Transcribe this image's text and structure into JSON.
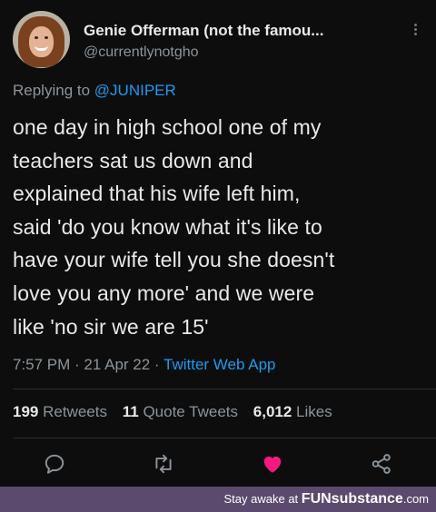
{
  "author": {
    "name": "Genie Offerman (not the famou...",
    "handle": "@currentlynotgho"
  },
  "reply": {
    "prefix": "Replying to ",
    "to": "@JUNIPER"
  },
  "tweet": {
    "lines": [
      "one day in high school one of my",
      "teachers sat us down and",
      "explained that his wife left him,",
      "said 'do you know what it's like to",
      "have your wife tell you she doesn't",
      "love you any more' and we were",
      "like 'no sir we are 15'"
    ],
    "time": "7:57 PM",
    "sep1": " · ",
    "date": "21 Apr 22",
    "sep2": " · ",
    "app": "Twitter Web App"
  },
  "stats": {
    "retweets_count": "199",
    "retweets_label": "Retweets",
    "quotes_count": "11",
    "quotes_label": "Quote Tweets",
    "likes_count": "6,012",
    "likes_label": "Likes"
  },
  "actions": [
    "reply-icon",
    "retweet-icon",
    "like-icon",
    "share-icon"
  ],
  "colors": {
    "accent": "#1d9bf0",
    "like": "#f91880",
    "banner": "#5b4a6e"
  },
  "banner": {
    "text": "Stay awake at ",
    "brand": "FUNsubstance",
    "suffix": ".com"
  }
}
